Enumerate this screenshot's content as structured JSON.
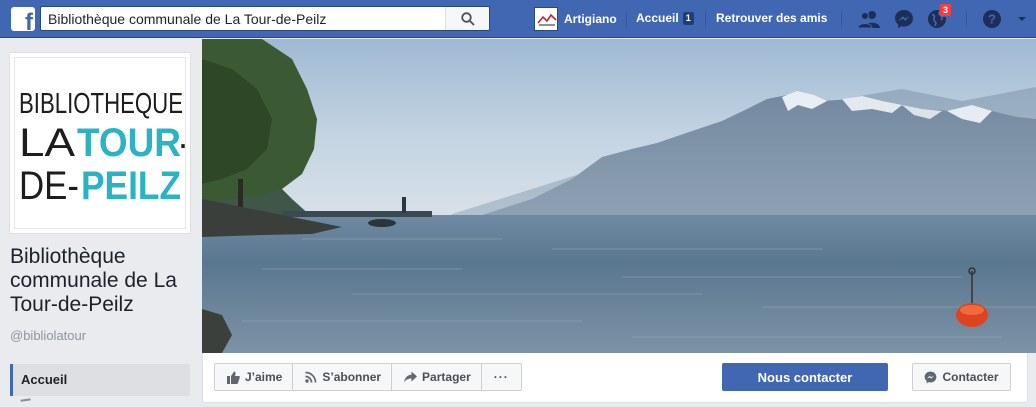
{
  "topbar": {
    "search_value": "Bibliothèque communale de La Tour-de-Peilz",
    "profile_name": "Artigiano",
    "home_label": "Accueil",
    "home_count": "1",
    "find_friends_label": "Retrouver des amis",
    "notifications_count": "3"
  },
  "page": {
    "title": "Bibliothèque communale de La Tour-de-Peilz",
    "handle": "@bibliolatour",
    "logo_lines": [
      "BIBLIOTHEQUE",
      "LA TOUR-",
      "DE-PEILZ"
    ]
  },
  "left_nav": {
    "active_item": "Accueil"
  },
  "actions": {
    "like_label": "J’aime",
    "follow_label": "S’abonner",
    "share_label": "Partager",
    "more_label": "···",
    "contact_primary_label": "Nous contacter",
    "contact_secondary_label": "Contacter"
  },
  "colors": {
    "brand_blue": "#4267b2",
    "logo_teal": "#2bb3c4",
    "notification_red": "#fa3e3e"
  },
  "icons": [
    "facebook-logo-icon",
    "search-icon",
    "friend-requests-icon",
    "messenger-icon",
    "notifications-globe-icon",
    "help-icon",
    "like-icon",
    "rss-icon",
    "share-arrow-icon",
    "messenger-small-icon"
  ]
}
